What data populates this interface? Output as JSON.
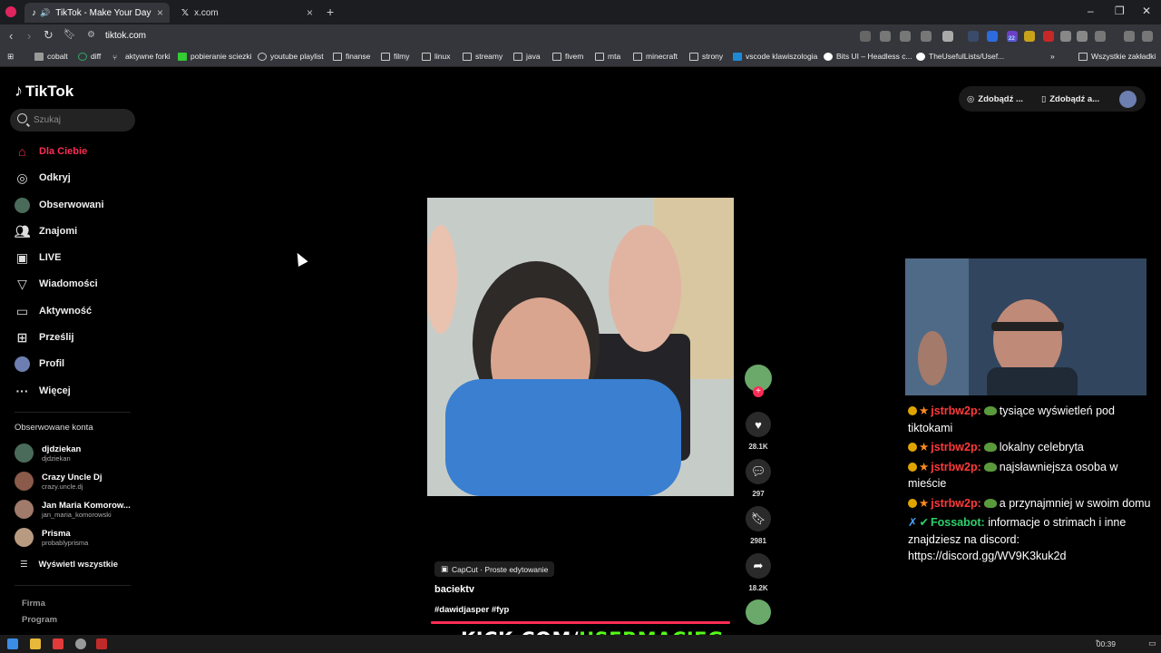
{
  "browser": {
    "tabs": [
      {
        "title": "TikTok - Make Your Day",
        "active": true
      },
      {
        "title": "x.com",
        "active": false
      }
    ],
    "url": "tiktok.com",
    "bookmarks": [
      "cobalt",
      "diff",
      "aktywne forki",
      "pobieranie sciezki",
      "youtube playlist",
      "finanse",
      "filmy",
      "linux",
      "streamy",
      "java",
      "fivem",
      "mta",
      "minecraft",
      "strony",
      "vscode klawiszologia",
      "Bits UI – Headless c...",
      "TheUsefulLists/Usef...",
      "Wszystkie zakładki"
    ],
    "extension_badge": "22"
  },
  "tiktok": {
    "logo": "TikTok",
    "search_placeholder": "Szukaj",
    "nav": [
      {
        "label": "Dla Ciebie",
        "icon": "home-icon",
        "active": true
      },
      {
        "label": "Odkryj",
        "icon": "compass-icon"
      },
      {
        "label": "Obserwowani",
        "icon": "following-avatar-icon"
      },
      {
        "label": "Znajomi",
        "icon": "friends-icon"
      },
      {
        "label": "LIVE",
        "icon": "live-icon"
      },
      {
        "label": "Wiadomości",
        "icon": "messages-icon"
      },
      {
        "label": "Aktywność",
        "icon": "activity-icon"
      },
      {
        "label": "Prześlij",
        "icon": "upload-icon"
      },
      {
        "label": "Profil",
        "icon": "profile-avatar-icon"
      },
      {
        "label": "Więcej",
        "icon": "more-icon"
      }
    ],
    "followed_title": "Obserwowane konta",
    "followed": [
      {
        "name": "djdziekan",
        "handle": "djdziekan"
      },
      {
        "name": "Crazy Uncle Dj",
        "handle": "crazy.uncle.dj"
      },
      {
        "name": "Jan Maria Komorow...",
        "handle": "jan_maria_komorowski"
      },
      {
        "name": "Prisma",
        "handle": "probablyprisma"
      }
    ],
    "see_all": "Wyświetl wszystkie",
    "footer": [
      "Firma",
      "Program"
    ],
    "header_buttons": [
      "Zdobądź ...",
      "Zdobądź a..."
    ],
    "video": {
      "capcut": "CapCut · Proste edytowanie",
      "author": "baciektv",
      "tags": "#dawidjasper #fyp",
      "likes": "28.1K",
      "comments": "297",
      "saves": "2981",
      "shares": "18.2K",
      "progress": 1.0
    }
  },
  "stream": {
    "chat": [
      {
        "user": "jstrbw2p:",
        "text": "tysiące wyświetleń pod tiktokami",
        "emote": true
      },
      {
        "user": "jstrbw2p:",
        "text": "lokalny celebryta",
        "emote": true
      },
      {
        "user": "jstrbw2p:",
        "text": "najsławniejsza osoba w mieście",
        "emote": true
      },
      {
        "user": "jstrbw2p:",
        "text": "a przynajmniej w swoim domu",
        "emote": true
      },
      {
        "user": "Fossabot:",
        "text": "informacje o strimach i inne znajdziesz na discord: https://discord.gg/WV9K3kuk2d",
        "bot": true
      }
    ],
    "kick_prefix": "KICK.COM/",
    "kick_user": "USERMACIEG"
  },
  "taskbar": {
    "clock": "00:39"
  },
  "colors": {
    "accent": "#fe2c55",
    "kick": "#53fc18"
  }
}
